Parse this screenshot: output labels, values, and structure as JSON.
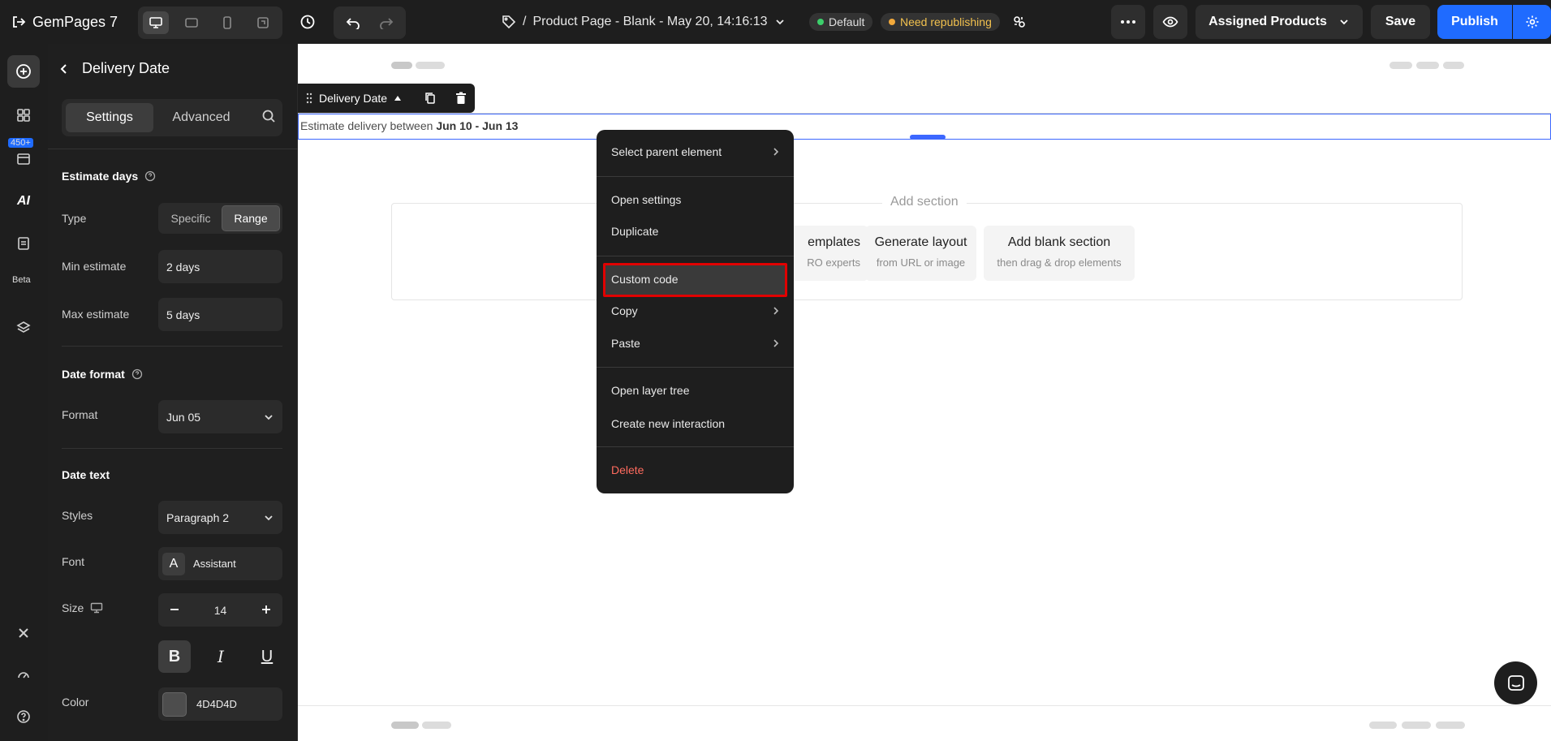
{
  "topbar": {
    "app_name": "GemPages 7",
    "page_prefix": "/",
    "page_title": "Product Page - Blank - May 20, 14:16:13",
    "badge_default": "Default",
    "badge_need": "Need republishing",
    "assigned_label": "Assigned Products",
    "save_label": "Save",
    "publish_label": "Publish"
  },
  "rail": {
    "count_badge": "450+",
    "beta_label": "Beta",
    "ai_label": "AI"
  },
  "panel": {
    "title": "Delivery Date",
    "tabs": [
      {
        "label": "Settings"
      },
      {
        "label": "Advanced"
      }
    ],
    "estimate_days": {
      "title": "Estimate days",
      "type_label": "Type",
      "type_options": [
        {
          "label": "Specific"
        },
        {
          "label": "Range"
        }
      ],
      "type_selected": "Range",
      "min_label": "Min estimate",
      "min_value": "2 days",
      "max_label": "Max estimate",
      "max_value": "5 days"
    },
    "date_format": {
      "title": "Date format",
      "format_label": "Format",
      "format_value": "Jun 05"
    },
    "date_text": {
      "title": "Date text",
      "styles_label": "Styles",
      "styles_value": "Paragraph 2",
      "font_label": "Font",
      "font_icon_letter": "A",
      "font_value": "Assistant",
      "size_label": "Size",
      "size_value": "14",
      "bold_glyph": "B",
      "italic_glyph": "I",
      "underline_glyph": "U",
      "color_label": "Color",
      "color_value": "4D4D4D",
      "color_hex": "#4D4D4D"
    }
  },
  "canvas": {
    "element_label": "Delivery Date",
    "text_prefix": "Estimate delivery between ",
    "text_dates": "Jun 10 - Jun 13",
    "add_section": "Add section",
    "cards": [
      {
        "title": "emplates",
        "sub": "RO experts"
      },
      {
        "title": "Generate layout",
        "sub": "from URL or image"
      },
      {
        "title": "Add blank section",
        "sub": "then drag & drop elements"
      }
    ]
  },
  "context_menu": {
    "select_parent": "Select parent element",
    "open_settings": "Open settings",
    "duplicate": "Duplicate",
    "custom_code": "Custom code",
    "copy": "Copy",
    "paste": "Paste",
    "open_layer_tree": "Open layer tree",
    "create_interaction": "Create new interaction",
    "delete": "Delete"
  },
  "colors": {
    "accent": "#1f6bff",
    "selection": "#3c67ff",
    "highlight_border": "#e00000",
    "danger": "#ff6b5e"
  }
}
